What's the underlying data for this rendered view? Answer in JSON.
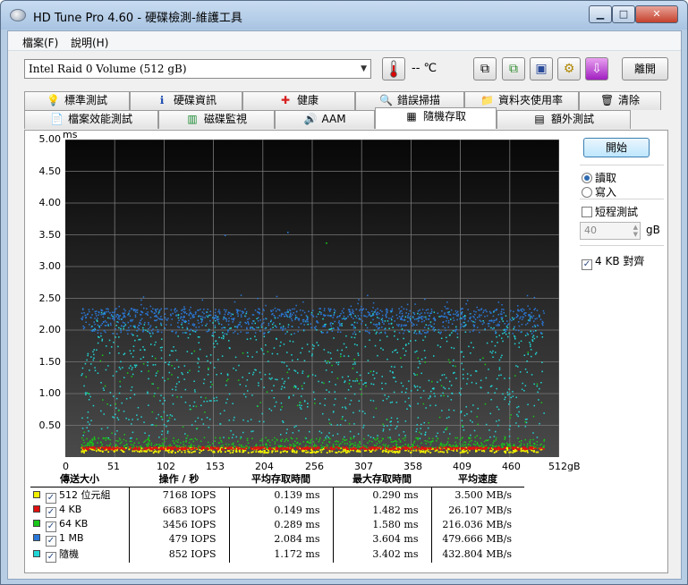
{
  "window": {
    "title": "HD Tune Pro 4.60 - 硬碟檢測-維護工具"
  },
  "menu": {
    "file": "檔案(F)",
    "help": "說明(H)"
  },
  "toolbar": {
    "drive": "Intel  Raid 0 Volume (512 gB)",
    "temperature": "-- ℃",
    "exit_label": "離開"
  },
  "tabs_top": [
    {
      "label": "標準測試",
      "icon": "lightbulb-icon"
    },
    {
      "label": "硬碟資訊",
      "icon": "info-icon"
    },
    {
      "label": "健康",
      "icon": "health-cross-icon"
    },
    {
      "label": "錯誤掃描",
      "icon": "magnifier-icon"
    },
    {
      "label": "資料夾使用率",
      "icon": "folder-icon"
    },
    {
      "label": "清除",
      "icon": "trash-icon"
    }
  ],
  "tabs_bottom": [
    {
      "label": "檔案效能測試",
      "icon": "file-bench-icon"
    },
    {
      "label": "磁碟監視",
      "icon": "monitor-icon"
    },
    {
      "label": "AAM",
      "icon": "speaker-icon"
    },
    {
      "label": "隨機存取",
      "icon": "random-access-icon",
      "active": true
    },
    {
      "label": "額外測試",
      "icon": "extra-tests-icon"
    }
  ],
  "chart_data": {
    "type": "scatter",
    "ylabel": "ms",
    "xlabel": "",
    "x_unit": "gB",
    "ylim": [
      0,
      5.0
    ],
    "xlim": [
      0,
      512
    ],
    "y_ticks": [
      "5.00",
      "4.50",
      "4.00",
      "3.50",
      "3.00",
      "2.50",
      "2.00",
      "1.50",
      "1.00",
      "0.50"
    ],
    "x_ticks": [
      "0",
      "51",
      "102",
      "153",
      "204",
      "256",
      "307",
      "358",
      "409",
      "460",
      "512gB"
    ],
    "grid": true,
    "series": [
      {
        "name": "512 位元組",
        "color": "#f0f000",
        "band": [
          0.08,
          0.16
        ],
        "outliers": []
      },
      {
        "name": "4 KB",
        "color": "#e01010",
        "band": [
          0.13,
          0.17
        ],
        "outliers": []
      },
      {
        "name": "64 KB",
        "color": "#18c818",
        "band": [
          0.15,
          0.32
        ],
        "outliers": [
          [
            270,
            3.38
          ]
        ]
      },
      {
        "name": "1 MB",
        "color": "#2a78d8",
        "band": [
          1.95,
          2.35
        ],
        "outliers": [
          [
            165,
            3.5
          ],
          [
            230,
            3.55
          ]
        ]
      },
      {
        "name": "隨機",
        "color": "#20d8d8",
        "band": [
          0.3,
          2.3
        ],
        "outliers": []
      }
    ]
  },
  "controls": {
    "start_label": "開始",
    "read_label": "讀取",
    "write_label": "寫入",
    "short_stroke_label": "短程測試",
    "short_stroke_value": "40",
    "short_stroke_unit": "gB",
    "align_label": "4 KB 對齊"
  },
  "stats": {
    "headers": [
      "傳送大小",
      "操作 / 秒",
      "平均存取時間",
      "最大存取時間",
      "平均速度"
    ],
    "rows": [
      {
        "size": "512 位元組",
        "color": "#f0f000",
        "iops": "7168 IOPS",
        "avg": "0.139 ms",
        "max": "0.290 ms",
        "speed": "3.500 MB/s"
      },
      {
        "size": "4 KB",
        "color": "#e01010",
        "iops": "6683 IOPS",
        "avg": "0.149 ms",
        "max": "1.482 ms",
        "speed": "26.107 MB/s"
      },
      {
        "size": "64 KB",
        "color": "#18c818",
        "iops": "3456 IOPS",
        "avg": "0.289 ms",
        "max": "1.580 ms",
        "speed": "216.036 MB/s"
      },
      {
        "size": "1 MB",
        "color": "#2a78d8",
        "iops": "479 IOPS",
        "avg": "2.084 ms",
        "max": "3.604 ms",
        "speed": "479.666 MB/s"
      },
      {
        "size": "隨機",
        "color": "#20d8d8",
        "iops": "852 IOPS",
        "avg": "1.172 ms",
        "max": "3.402 ms",
        "speed": "432.804 MB/s"
      }
    ]
  }
}
